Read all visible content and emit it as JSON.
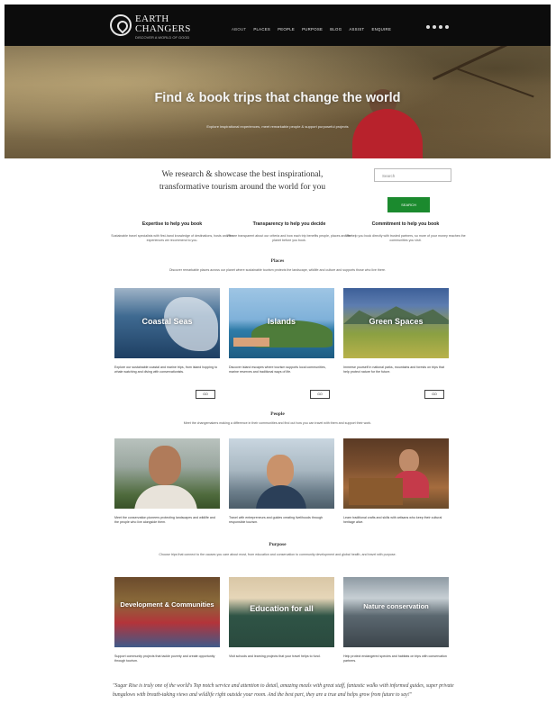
{
  "header": {
    "logo_line1": "EARTH",
    "logo_line2": "CHANGERS",
    "logo_tag": "DISCOVER A WORLD OF GOOD",
    "nav": [
      "ABOUT",
      "PLACES",
      "PEOPLE",
      "PURPOSE",
      "BLOG",
      "ASSIST",
      "ENQUIRE"
    ],
    "social_icons": [
      "twitter-icon",
      "facebook-icon",
      "instagram-icon",
      "pinterest-icon"
    ]
  },
  "hero": {
    "title": "Find & book trips that change the world",
    "subtitle": "Explore inspirational experiences, meet remarkable people & support purposeful projects"
  },
  "intro": {
    "text": "We research & showcase the best inspirational, transformative tourism around the world for you",
    "search_placeholder": "Search",
    "search_button": "SEARCH"
  },
  "values": [
    {
      "heading": "Expertise to help you book",
      "text": "Sustainable travel specialists with first-hand knowledge of destinations, hosts and the experiences we recommend to you."
    },
    {
      "heading": "Transparency to help you decide",
      "text": "We are transparent about our criteria and how each trip benefits people, places and the planet before you book."
    },
    {
      "heading": "Commitment to help you book",
      "text": "We help you book directly with trusted partners, so more of your money reaches the communities you visit."
    }
  ],
  "places": {
    "title": "Places",
    "text": "Discover remarkable places across our planet where sustainable tourism protects the landscape, wildlife and culture and supports those who live there.",
    "cards": [
      {
        "label": "Coastal Seas",
        "caption": "Explore our sustainable coastal and marine trips, from island hopping to whale watching and diving with conservationists.",
        "button": "GO"
      },
      {
        "label": "Islands",
        "caption": "Discover island escapes where tourism supports local communities, marine reserves and traditional ways of life.",
        "button": "GO"
      },
      {
        "label": "Green Spaces",
        "caption": "Immerse yourself in national parks, mountains and forests on trips that help protect nature for the future.",
        "button": "GO"
      }
    ]
  },
  "people": {
    "title": "People",
    "text": "Meet the changemakers making a difference in their communities and find out how you can travel with them and support their work.",
    "cards": [
      {
        "caption": "Meet the conservation pioneers protecting landscapes and wildlife and the people who live alongside them."
      },
      {
        "caption": "Travel with entrepreneurs and guides creating livelihoods through responsible tourism."
      },
      {
        "caption": "Learn traditional crafts and skills with artisans who keep their cultural heritage alive."
      }
    ]
  },
  "purpose": {
    "title": "Purpose",
    "text": "Choose trips that connect to the causes you care about most, from education and conservation to community development and global health, and travel with purpose.",
    "cards": [
      {
        "label": "Development & Communities",
        "caption": "Support community projects that tackle poverty and create opportunity through tourism."
      },
      {
        "label": "Education for all",
        "caption": "Visit schools and learning projects that your travel helps to fund."
      },
      {
        "label": "Nature conservation",
        "caption": "Help protect endangered species and habitats on trips with conservation partners."
      }
    ]
  },
  "quote": "\"Sugar Rise is truly one of the world's Top notch service and attention to detail, amazing meals with great staff, fantastic walks with informed guides, super private bungalows with breath-taking views and wildlife right outside your room. And the best part, they are a true and helps grow from future to say!\""
}
